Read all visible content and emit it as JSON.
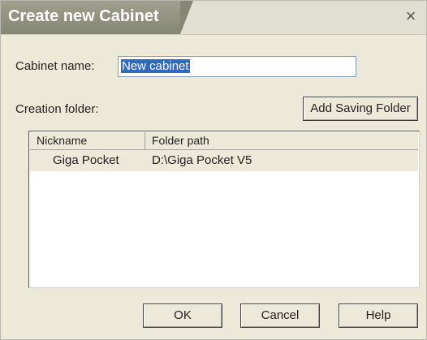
{
  "dialog": {
    "title": "Create new Cabinet",
    "close_glyph": "×",
    "cabinet_name_label": "Cabinet name:",
    "cabinet_name_value": "New cabinet",
    "creation_folder_label": "Creation folder:",
    "add_saving_folder_button": "Add Saving Folder",
    "list": {
      "columns": [
        "Nickname",
        "Folder path"
      ],
      "rows": [
        {
          "nickname": "Giga Pocket",
          "path": "D:\\Giga Pocket V5"
        }
      ]
    },
    "buttons": {
      "ok": "OK",
      "cancel": "Cancel",
      "help": "Help"
    }
  }
}
